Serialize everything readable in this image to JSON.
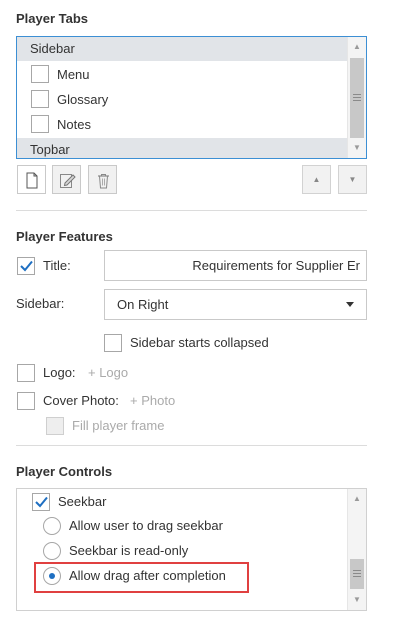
{
  "player_tabs": {
    "title": "Player Tabs",
    "groups": [
      {
        "label": "Sidebar",
        "items": [
          {
            "label": "Menu",
            "checked": false
          },
          {
            "label": "Glossary",
            "checked": false
          },
          {
            "label": "Notes",
            "checked": false
          }
        ]
      },
      {
        "label": "Topbar"
      }
    ],
    "toolbar": {
      "new_icon": "new-document-icon",
      "edit_icon": "edit-icon",
      "delete_icon": "trash-icon",
      "move_up_icon": "triangle-up-icon",
      "move_down_icon": "triangle-down-icon"
    }
  },
  "player_features": {
    "title": "Player Features",
    "title_field": {
      "label": "Title:",
      "checked": true,
      "value": "Requirements for Supplier Er"
    },
    "sidebar_field": {
      "label": "Sidebar:",
      "value": "On Right"
    },
    "sidebar_collapsed": {
      "label": "Sidebar starts collapsed",
      "checked": false
    },
    "logo": {
      "label": "Logo:",
      "add_link": "+ Logo",
      "checked": false
    },
    "cover_photo": {
      "label": "Cover Photo:",
      "add_link": "+ Photo",
      "checked": false
    },
    "fill_frame": {
      "label": "Fill player frame",
      "checked": false,
      "disabled": true
    }
  },
  "player_controls": {
    "title": "Player Controls",
    "seekbar": {
      "label": "Seekbar",
      "checked": true
    },
    "options": [
      {
        "label": "Allow user to drag seekbar",
        "selected": false
      },
      {
        "label": "Seekbar is read-only",
        "selected": false
      },
      {
        "label": "Allow drag after completion",
        "selected": true
      }
    ]
  },
  "colors": {
    "accent": "#1e6fc2",
    "focus_border": "#3c8fd4",
    "highlight": "#e04040",
    "group_row_bg": "#e1e4e8"
  }
}
